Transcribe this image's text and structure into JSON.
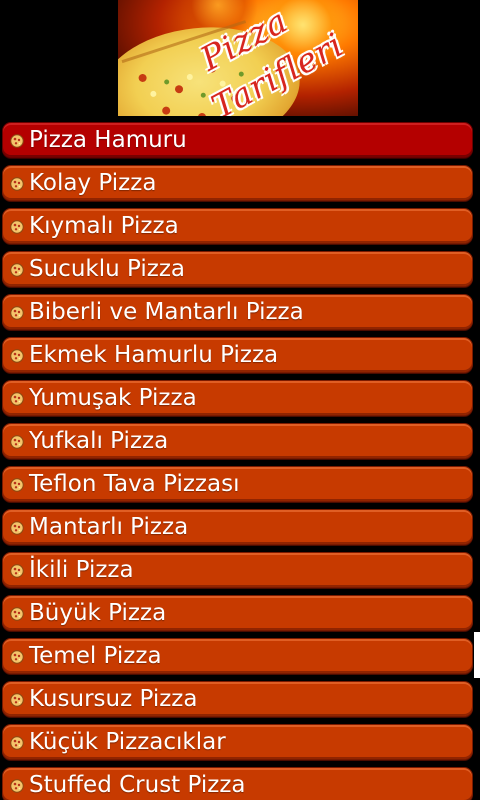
{
  "banner": {
    "title_line1": "Pizza",
    "title_line2": "Tarifleri"
  },
  "colors": {
    "item_background": "#c73a00",
    "item_selected_background": "#b40000",
    "screen_background": "#000000",
    "text": "#ffffff"
  },
  "list": {
    "selected_index": 0,
    "bullet_icon": "pizza-icon",
    "items": [
      {
        "label": "Pizza Hamuru"
      },
      {
        "label": "Kolay Pizza"
      },
      {
        "label": "Kıymalı Pizza"
      },
      {
        "label": "Sucuklu Pizza"
      },
      {
        "label": "Biberli ve Mantarlı Pizza"
      },
      {
        "label": "Ekmek Hamurlu Pizza"
      },
      {
        "label": "Yumuşak Pizza"
      },
      {
        "label": "Yufkalı Pizza"
      },
      {
        "label": "Teflon Tava Pizzası"
      },
      {
        "label": "Mantarlı Pizza"
      },
      {
        "label": "İkili Pizza"
      },
      {
        "label": "Büyük Pizza"
      },
      {
        "label": "Temel Pizza"
      },
      {
        "label": "Kusursuz Pizza"
      },
      {
        "label": "Küçük Pizzacıklar"
      },
      {
        "label": "Stuffed Crust Pizza"
      }
    ]
  }
}
